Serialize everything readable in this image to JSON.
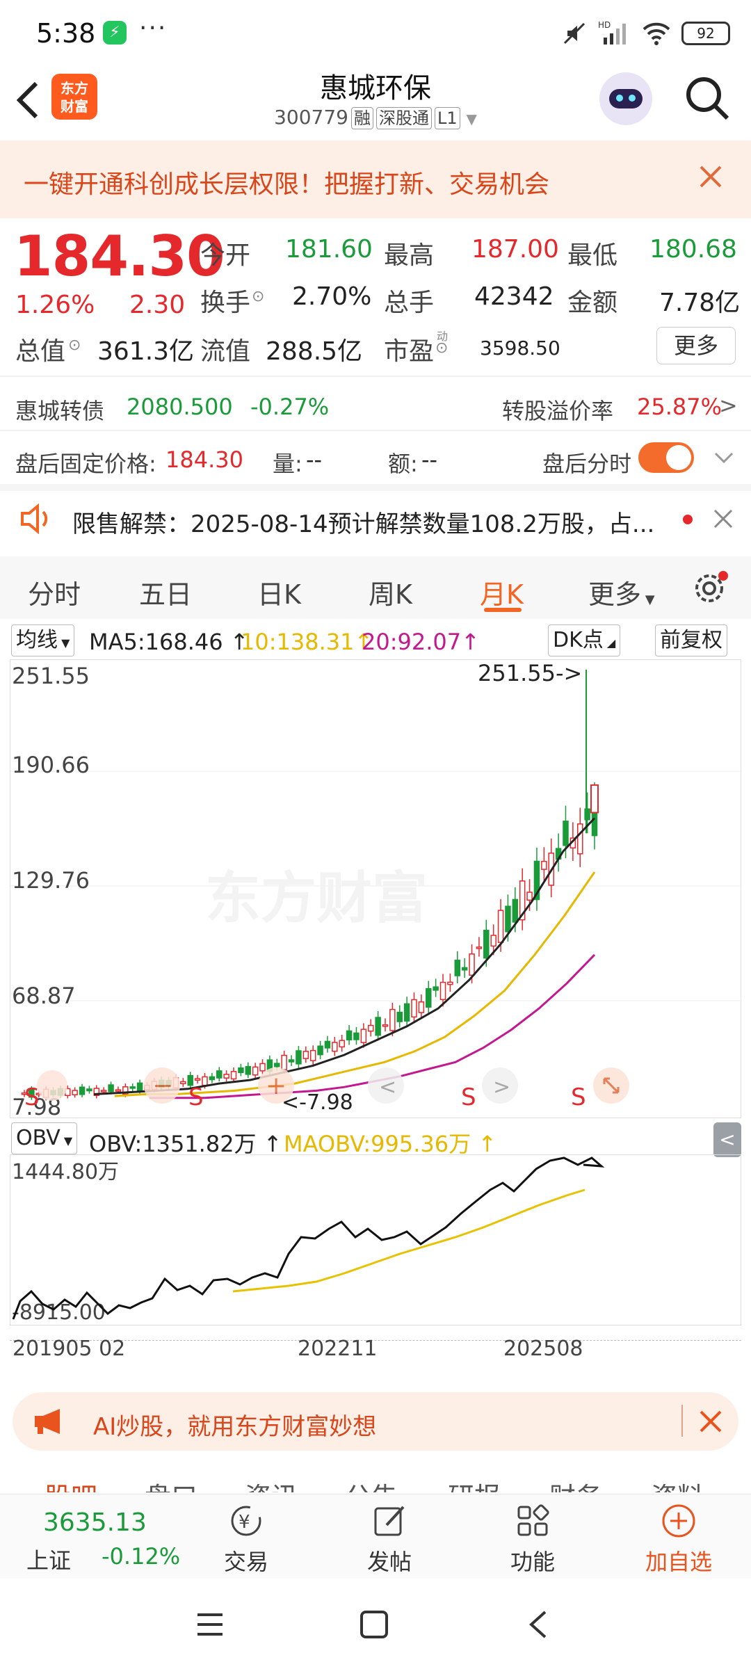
{
  "status_bar": {
    "time": "5:38",
    "battery": "92",
    "network": "HD"
  },
  "header": {
    "logo_line1": "东方",
    "logo_line2": "财富",
    "stock_name": "惠城环保",
    "stock_code": "300779",
    "tags": [
      "融",
      "深股通",
      "L1"
    ]
  },
  "banner": {
    "text": "一键开通科创成长层权限！把握打新、交易机会"
  },
  "quote": {
    "price": "184.30",
    "change_pct": "1.26%",
    "change": "2.30",
    "open_label": "今开",
    "open": "181.60",
    "high_label": "最高",
    "high": "187.00",
    "low_label": "最低",
    "low": "180.68",
    "turnover_label": "换手",
    "turnover": "2.70%",
    "volume_label": "总手",
    "volume": "42342",
    "amount_label": "金额",
    "amount": "7.78亿",
    "mktcap_label": "总值",
    "mktcap": "361.3亿",
    "float_label": "流值",
    "float_cap": "288.5亿",
    "pe_label": "市盈",
    "pe_sup": "动",
    "pe": "3598.50",
    "more": "更多"
  },
  "bond": {
    "name": "惠城转债",
    "price": "2080.500",
    "change": "-0.27%",
    "premium_label": "转股溢价率",
    "premium": "25.87%"
  },
  "after_hours": {
    "label": "盘后固定价格:",
    "price": "184.30",
    "vol_label": "量:",
    "vol": "--",
    "amt_label": "额:",
    "amt": "--",
    "toggle_label": "盘后分时"
  },
  "notice": {
    "text": "限售解禁：2025-08-14预计解禁数量108.2万股，占..."
  },
  "tabs": [
    "分时",
    "五日",
    "日K",
    "周K",
    "月K",
    "更多"
  ],
  "active_tab": "月K",
  "kline_toolbar": {
    "ma_select": "均线",
    "ma5": "MA5:168.46",
    "ma10": "10:138.31",
    "ma20": "20:92.07",
    "dk": "DK点",
    "adjust": "前复权"
  },
  "kline_axis": {
    "y1": "251.55",
    "y2": "190.66",
    "y3": "129.76",
    "y4": "68.87",
    "y5": "7.98",
    "max_marker": "251.55->",
    "min_marker": "<-7.98"
  },
  "obv_toolbar": {
    "select": "OBV",
    "obv": "OBV:1351.82万",
    "maobv": "MAOBV:995.36万"
  },
  "obv_axis": {
    "top": "1444.80万",
    "bottom": "-8915.00"
  },
  "x_axis": {
    "d1": "201905",
    "d1b": "02",
    "d2": "202211",
    "d3": "202508"
  },
  "colors": {
    "up": "#e5282b",
    "down": "#1a9b3a",
    "ma5": "#222222",
    "ma10": "#e6b800",
    "ma20": "#c2198f",
    "accent": "#f26522"
  },
  "ai_banner": {
    "text": "AI炒股，就用东方财富妙想"
  },
  "bottom_section_tabs": [
    "股吧",
    "盘口",
    "资讯",
    "公告",
    "研报",
    "财务",
    "资料"
  ],
  "bottom_nav": {
    "index_value": "3635.13",
    "index_name": "上证",
    "index_change": "-0.12%",
    "trade": "交易",
    "post": "发帖",
    "functions": "功能",
    "add": "加自选"
  },
  "chart_data": {
    "type": "candlestick",
    "title": "",
    "ylim": [
      7.98,
      251.55
    ],
    "series": [
      {
        "name": "MA5",
        "values": [
          14,
          15,
          16,
          17,
          20,
          22,
          26,
          30,
          36,
          44,
          52,
          62,
          78,
          98,
          122,
          150,
          168.46
        ]
      },
      {
        "name": "MA10",
        "values": [
          13,
          14,
          14,
          15,
          16,
          18,
          20,
          24,
          28,
          32,
          38,
          46,
          58,
          72,
          92,
          114,
          138.31
        ]
      },
      {
        "name": "MA20",
        "values": [
          12,
          12,
          12,
          13,
          14,
          15,
          16,
          18,
          21,
          24,
          28,
          32,
          40,
          50,
          62,
          76,
          92.07
        ]
      }
    ],
    "ohlc_last": {
      "open": 181.6,
      "high": 187.0,
      "low": 180.68,
      "close": 184.3
    },
    "highest": 251.55,
    "lowest": 7.98
  }
}
